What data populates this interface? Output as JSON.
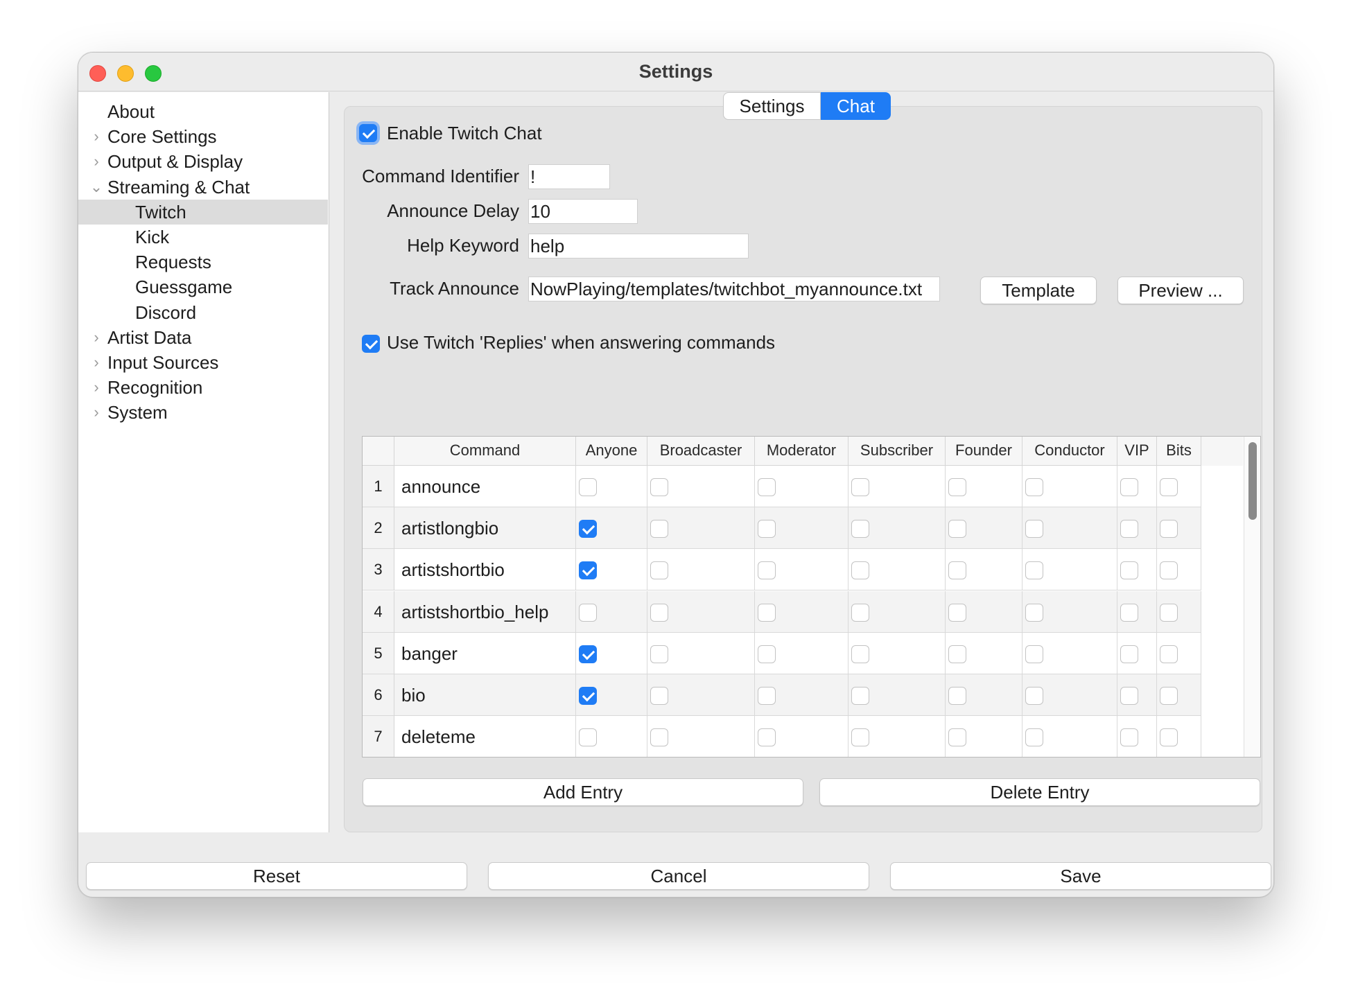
{
  "window": {
    "title": "Settings"
  },
  "sidebar": {
    "items": [
      {
        "label": "About",
        "arrow": ""
      },
      {
        "label": "Core Settings",
        "arrow": "›"
      },
      {
        "label": "Output & Display",
        "arrow": "›"
      },
      {
        "label": "Streaming & Chat",
        "arrow": "⌄"
      },
      {
        "label": "Twitch",
        "arrow": ""
      },
      {
        "label": "Kick",
        "arrow": ""
      },
      {
        "label": "Requests",
        "arrow": ""
      },
      {
        "label": "Guessgame",
        "arrow": ""
      },
      {
        "label": "Discord",
        "arrow": ""
      },
      {
        "label": "Artist Data",
        "arrow": "›"
      },
      {
        "label": "Input Sources",
        "arrow": "›"
      },
      {
        "label": "Recognition",
        "arrow": "›"
      },
      {
        "label": "System",
        "arrow": "›"
      }
    ],
    "selected": "Twitch"
  },
  "tabs": {
    "settings": "Settings",
    "chat": "Chat",
    "active": "Chat"
  },
  "chat": {
    "enable_label": "Enable Twitch Chat",
    "enable_checked": true,
    "command_identifier_label": "Command Identifier",
    "command_identifier_value": "!",
    "announce_delay_label": "Announce Delay",
    "announce_delay_value": "10",
    "help_keyword_label": "Help Keyword",
    "help_keyword_value": "help",
    "track_announce_label": "Track Announce",
    "track_announce_value": "NowPlaying/templates/twitchbot_myannounce.txt",
    "template_button": "Template",
    "preview_button": "Preview ...",
    "replies_label": "Use Twitch 'Replies' when answering commands",
    "replies_checked": true,
    "table": {
      "headers": [
        "Command",
        "Anyone",
        "Broadcaster",
        "Moderator",
        "Subscriber",
        "Founder",
        "Conductor",
        "VIP",
        "Bits"
      ],
      "rows": [
        {
          "num": "1",
          "command": "announce",
          "checks": [
            false,
            false,
            false,
            false,
            false,
            false,
            false,
            false
          ]
        },
        {
          "num": "2",
          "command": "artistlongbio",
          "checks": [
            true,
            false,
            false,
            false,
            false,
            false,
            false,
            false
          ]
        },
        {
          "num": "3",
          "command": "artistshortbio",
          "checks": [
            true,
            false,
            false,
            false,
            false,
            false,
            false,
            false
          ]
        },
        {
          "num": "4",
          "command": "artistshortbio_help",
          "checks": [
            false,
            false,
            false,
            false,
            false,
            false,
            false,
            false
          ]
        },
        {
          "num": "5",
          "command": "banger",
          "checks": [
            true,
            false,
            false,
            false,
            false,
            false,
            false,
            false
          ]
        },
        {
          "num": "6",
          "command": "bio",
          "checks": [
            true,
            false,
            false,
            false,
            false,
            false,
            false,
            false
          ]
        },
        {
          "num": "7",
          "command": "deleteme",
          "checks": [
            false,
            false,
            false,
            false,
            false,
            false,
            false,
            false
          ]
        }
      ]
    },
    "add_entry_button": "Add Entry",
    "delete_entry_button": "Delete Entry"
  },
  "footer": {
    "reset": "Reset",
    "cancel": "Cancel",
    "save": "Save"
  },
  "colors": {
    "accent": "#1f7cf5",
    "close": "#ff5f57",
    "minimize": "#febc2e",
    "maximize": "#28c840"
  }
}
